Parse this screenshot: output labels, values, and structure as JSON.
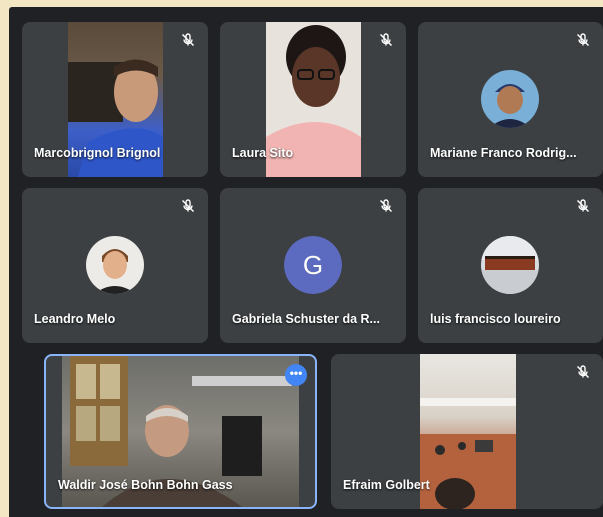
{
  "participants": [
    {
      "name": "Marcobrignol Brignol",
      "muted": true,
      "media": "video"
    },
    {
      "name": "Laura Sito",
      "muted": true,
      "media": "video"
    },
    {
      "name": "Mariane Franco Rodrig...",
      "muted": true,
      "media": "photo"
    },
    {
      "name": "Leandro Melo",
      "muted": true,
      "media": "photo"
    },
    {
      "name": "Gabriela Schuster da R...",
      "muted": true,
      "media": "initial",
      "initial": "G",
      "avatar_color": "#5c6bc0"
    },
    {
      "name": "luis francisco loureiro",
      "muted": true,
      "media": "photo"
    },
    {
      "name": "Waldir José Bohn Bohn Gass",
      "muted": false,
      "media": "video",
      "active": true,
      "more_label": "•••"
    },
    {
      "name": "Efraim Golbert",
      "muted": true,
      "media": "video"
    }
  ],
  "colors": {
    "background": "#202124",
    "tile": "#3c4043",
    "active_border": "#8ab4f8",
    "accent": "#4285f4"
  }
}
